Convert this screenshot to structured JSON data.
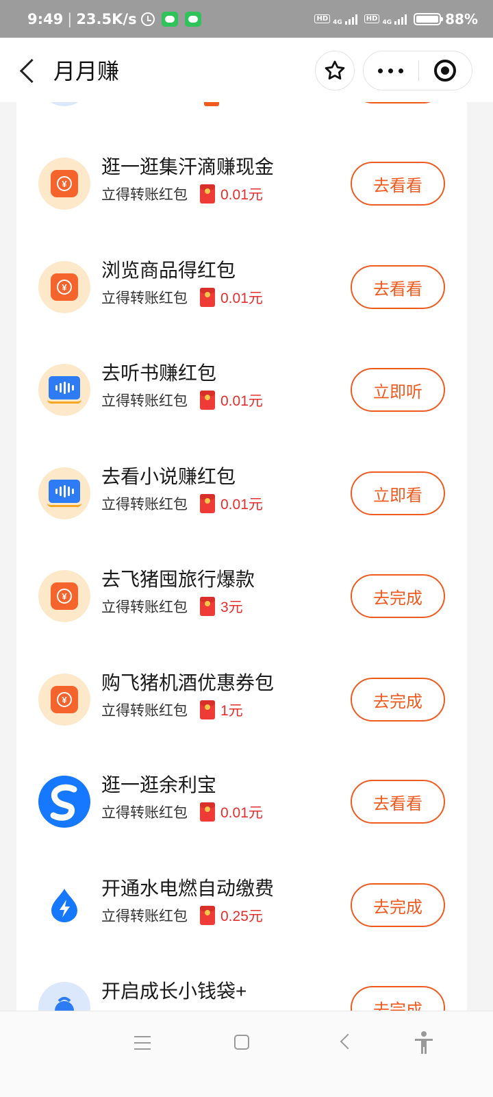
{
  "status_bar": {
    "time": "9:49",
    "speed": "23.5K/s",
    "battery": "88%",
    "network_1": "4G",
    "network_2": "4G",
    "hd_1": "HD",
    "hd_2": "HD"
  },
  "header": {
    "title": "月月赚"
  },
  "tasks": [
    {
      "title": "逛一逛集汗滴赚现金",
      "subtitle": "立得转账红包",
      "amount": "0.01元",
      "button": "去看看",
      "icon": "yen-bag-icon"
    },
    {
      "title": "浏览商品得红包",
      "subtitle": "立得转账红包",
      "amount": "0.01元",
      "button": "去看看",
      "icon": "yen-bag-icon"
    },
    {
      "title": "去听书赚红包",
      "subtitle": "立得转账红包",
      "amount": "0.01元",
      "button": "立即听",
      "icon": "audiobook-icon"
    },
    {
      "title": "去看小说赚红包",
      "subtitle": "立得转账红包",
      "amount": "0.01元",
      "button": "立即看",
      "icon": "audiobook-icon"
    },
    {
      "title": "去飞猪囤旅行爆款",
      "subtitle": "立得转账红包",
      "amount": "3元",
      "button": "去完成",
      "icon": "yen-bag-icon"
    },
    {
      "title": "购飞猪机酒优惠券包",
      "subtitle": "立得转账红包",
      "amount": "1元",
      "button": "去完成",
      "icon": "yen-bag-icon"
    },
    {
      "title": "逛一逛余利宝",
      "subtitle": "立得转账红包",
      "amount": "0.01元",
      "button": "去看看",
      "icon": "yulibao-icon"
    },
    {
      "title": "开通水电燃自动缴费",
      "subtitle": "立得转账红包",
      "amount": "0.25元",
      "button": "去完成",
      "icon": "utility-bolt-icon"
    },
    {
      "title": "开启成长小钱袋+",
      "subtitle": "",
      "amount": "",
      "button": "去完成",
      "icon": "money-bag-icon"
    }
  ],
  "colors": {
    "accent": "#f05a1f",
    "amount": "#e62d2d",
    "status_bar": "#9c9c9c"
  }
}
